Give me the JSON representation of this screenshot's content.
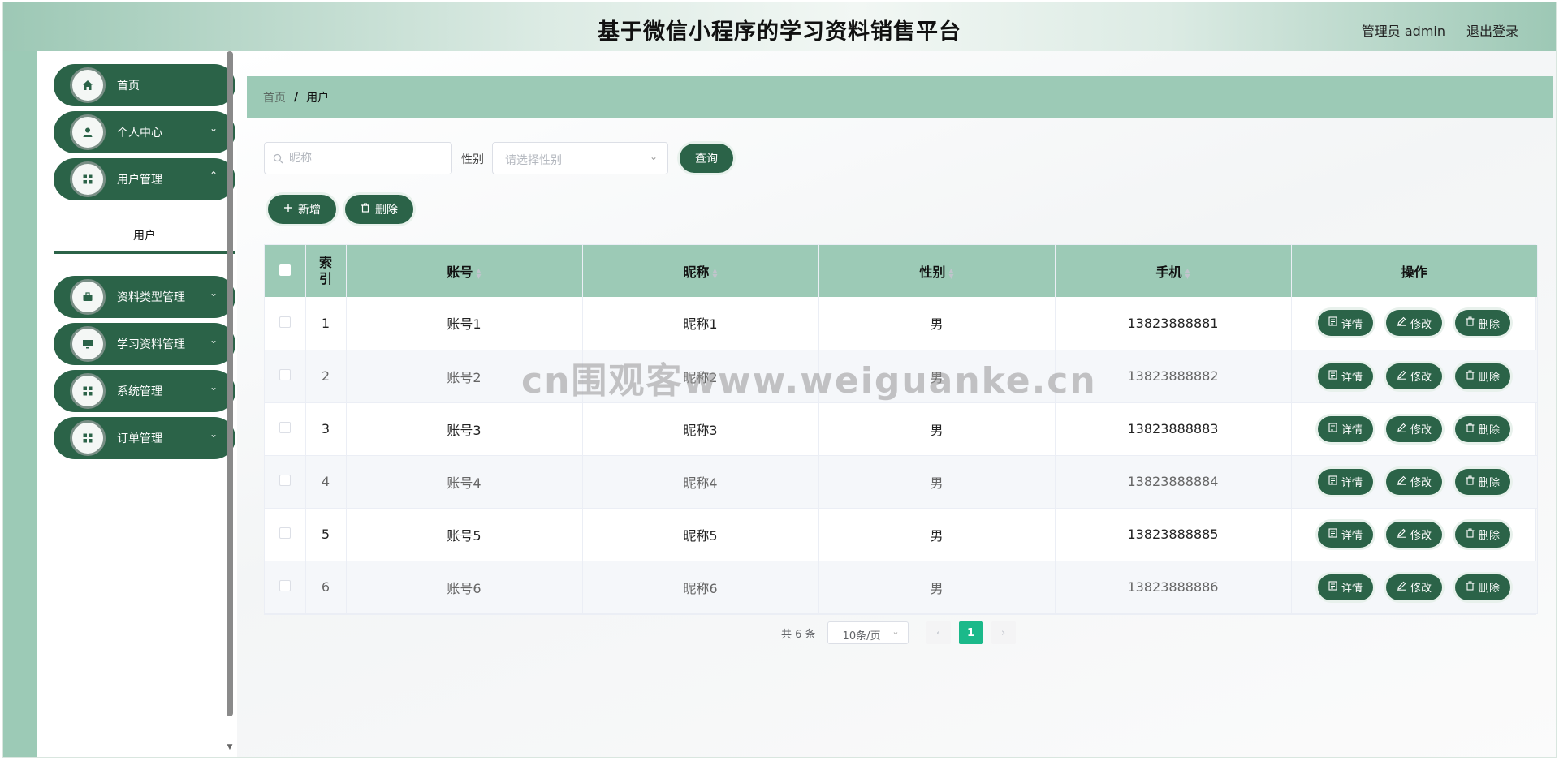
{
  "header": {
    "title": "基于微信小程序的学习资料销售平台",
    "user": "管理员 admin",
    "logout": "退出登录"
  },
  "sidebar": {
    "items": [
      {
        "label": "首页",
        "icon": "home-icon",
        "has_children": false
      },
      {
        "label": "个人中心",
        "icon": "user-icon",
        "has_children": true
      },
      {
        "label": "用户管理",
        "icon": "grid-icon",
        "has_children": true
      },
      {
        "label": "资料类型管理",
        "icon": "briefcase-icon",
        "has_children": true
      },
      {
        "label": "学习资料管理",
        "icon": "monitor-icon",
        "has_children": true
      },
      {
        "label": "系统管理",
        "icon": "grid-icon",
        "has_children": true
      },
      {
        "label": "订单管理",
        "icon": "grid-icon",
        "has_children": true
      }
    ],
    "submenu": {
      "label": "用户"
    }
  },
  "breadcrumb": {
    "home": "首页",
    "separator": "/",
    "current": "用户"
  },
  "search": {
    "nickname_placeholder": "昵称",
    "gender_label": "性别",
    "gender_placeholder": "请选择性别",
    "query_label": "查询"
  },
  "toolbar": {
    "add_label": "新增",
    "delete_label": "删除"
  },
  "table": {
    "headers": {
      "index": "索引",
      "account": "账号",
      "nickname": "昵称",
      "gender": "性别",
      "phone": "手机",
      "actions": "操作"
    },
    "actions": {
      "detail": "详情",
      "edit": "修改",
      "delete": "删除"
    },
    "rows": [
      {
        "index": "1",
        "account": "账号1",
        "nickname": "昵称1",
        "gender": "男",
        "phone": "13823888881"
      },
      {
        "index": "2",
        "account": "账号2",
        "nickname": "昵称2",
        "gender": "男",
        "phone": "13823888882"
      },
      {
        "index": "3",
        "account": "账号3",
        "nickname": "昵称3",
        "gender": "男",
        "phone": "13823888883"
      },
      {
        "index": "4",
        "account": "账号4",
        "nickname": "昵称4",
        "gender": "男",
        "phone": "13823888884"
      },
      {
        "index": "5",
        "account": "账号5",
        "nickname": "昵称5",
        "gender": "男",
        "phone": "13823888885"
      },
      {
        "index": "6",
        "account": "账号6",
        "nickname": "昵称6",
        "gender": "男",
        "phone": "13823888886"
      }
    ]
  },
  "pagination": {
    "total": "共 6 条",
    "page_size": "10条/页",
    "current_page": "1"
  },
  "watermark": "cn围观客www.weiguanke.cn",
  "colors": {
    "primary": "#2b6348",
    "accent_light": "#9ccab6",
    "page_active": "#1bb98a"
  }
}
